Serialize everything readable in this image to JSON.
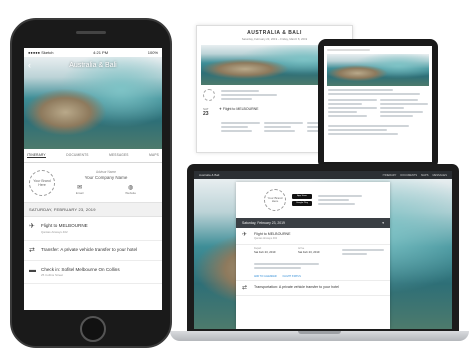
{
  "phone": {
    "status": {
      "carrier": "●●●●● Sketch",
      "time": "4:21 PM",
      "battery": "100%"
    },
    "hero_title": "Australia & Bali",
    "tabs": [
      "ITINERARY",
      "DOCUMENTS",
      "MESSAGES",
      "MAPS"
    ],
    "brand_logo": "Your Brand Here",
    "advisor_label": "Advisor Name",
    "advisor_company": "Your Company Name",
    "email_label": "Email",
    "website_label": "Website",
    "date_band": "SATURDAY, FEBRUARY 23, 2019",
    "items": [
      {
        "icon": "✈",
        "title": "Flight to MELBOURNE",
        "sub": "Qantas Airways 402"
      },
      {
        "icon": "⇄",
        "title": "Transfer: A private vehicle transfer to your hotel",
        "sub": ""
      },
      {
        "icon": "▬",
        "title": "Check in: Sofitel Melbourne On Collins",
        "sub": "25 Collins Street"
      }
    ]
  },
  "doc": {
    "title": "AUSTRALIA & BALI",
    "subtitle": "Saturday, February 23, 2019 – Friday, March 8, 2019",
    "day_label": "SAT",
    "day_num": "23",
    "flight": "✈ Flight to MELBOURNE"
  },
  "laptop": {
    "nav_left": "Australia & Bali",
    "nav_items": [
      "ITINERARY",
      "DOCUMENTS",
      "MAPS",
      "MESSAGES"
    ],
    "brand_logo": "Your Brand Here",
    "store_badges": [
      "App Store",
      "Google Play"
    ],
    "date": "Saturday, February 23, 2019",
    "flight": "Flight to MELBOURNE",
    "flight_sub": "Qantas Airways 402",
    "grid": [
      {
        "label": "Depart",
        "value": "Sat Feb 23, 2019"
      },
      {
        "label": "Arrive",
        "value": "Sat Feb 23, 2019"
      },
      {
        "label": "",
        "value": ""
      }
    ],
    "links": [
      "ADD TO CALENDAR",
      "FLIGHT STATUS"
    ],
    "transfer": "Transportation: A private vehicle transfer to your hotel"
  }
}
